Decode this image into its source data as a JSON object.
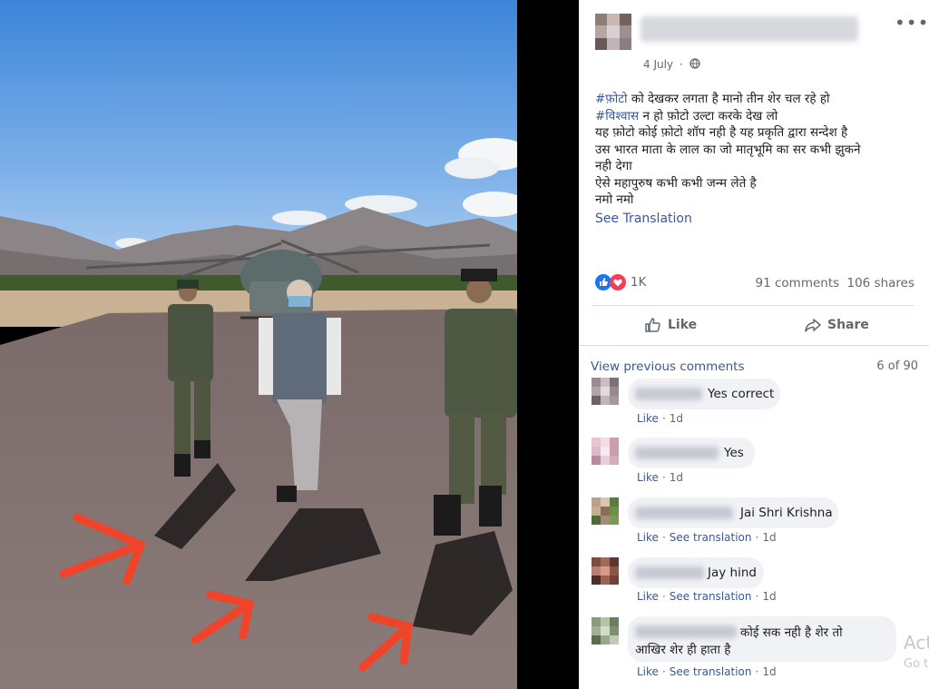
{
  "post": {
    "date": "4 July",
    "body_lines": [
      {
        "tag": "#फ़ोटो",
        "text": " को देखकर लगता है मानो तीन शेर चल रहे हो"
      },
      {
        "tag": "#विश्वास",
        "text": " न हो फ़ोटो उल्टा करके देख लो"
      },
      {
        "tag": "",
        "text": "यह फ़ोटो कोई फ़ोटो शॉप नही है यह प्रकृति द्वारा सन्देश है"
      },
      {
        "tag": "",
        "text": "उस भारत माता के लाल का जो मातृभूमि का सर कभी झुकने"
      },
      {
        "tag": "",
        "text": "नही देगा"
      },
      {
        "tag": "",
        "text": "ऐसे महापुरुष कभी कभी जन्म लेते है"
      },
      {
        "tag": "",
        "text": "नमो नमो"
      }
    ],
    "see_translation": "See Translation",
    "reaction_count": "1K",
    "comments_count": "91 comments",
    "shares_count": "106 shares",
    "like_label": "Like",
    "share_label": "Share"
  },
  "comments_section": {
    "view_previous": "View previous comments",
    "position": "6 of 90",
    "items": [
      {
        "text": "Yes correct",
        "actions": [
          "Like"
        ],
        "time": "1d"
      },
      {
        "text": "Yes",
        "actions": [
          "Like"
        ],
        "time": "1d"
      },
      {
        "text": "Jai Shri Krishna",
        "actions": [
          "Like",
          "See translation"
        ],
        "time": "1d"
      },
      {
        "text": "Jay hind",
        "actions": [
          "Like",
          "See translation"
        ],
        "time": "1d"
      },
      {
        "text": "कोई सक नही है शेर तो",
        "text2": "आखिर शेर ही हाता है",
        "actions": [
          "Like",
          "See translation"
        ],
        "time": "1d"
      }
    ]
  },
  "watermark": {
    "line1": "Act",
    "line2": "Go t"
  },
  "colors": {
    "accent": "#385898",
    "muted": "#65676b",
    "arrow": "#f0442a"
  },
  "icons": [
    "more-options-icon",
    "globe-icon",
    "like-reaction-icon",
    "love-reaction-icon",
    "thumbs-up-icon",
    "share-arrow-icon"
  ]
}
